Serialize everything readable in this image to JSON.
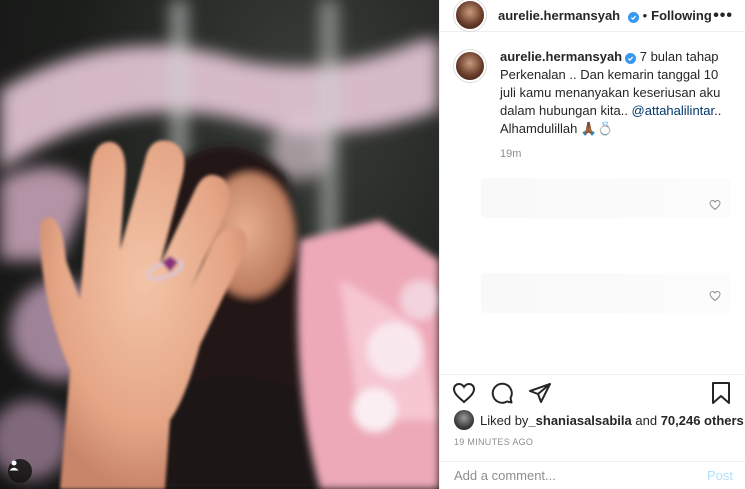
{
  "post": {
    "username": "aurelie.hermansyah",
    "separator": "•",
    "follow_label": "Following",
    "more_label": "•••"
  },
  "caption": {
    "username": "aurelie.hermansyah",
    "text_before": " 7 bulan tahap Perkenalan .. Dan kemarin tanggal 10 juli kamu menanyakan keseriusan aku dalam hubungan kita.. ",
    "mention": "@attahalilintar",
    "text_after": ".. Alhamdulillah 🙏🏾💍",
    "time": "19m"
  },
  "likes": {
    "prefix": "Liked by ",
    "user": "_shaniasalsabila",
    "middle": " and ",
    "count": "70,246 others"
  },
  "posted_time": "19 MINUTES AGO",
  "comment_input": {
    "placeholder": "Add a comment...",
    "post_label": "Post"
  },
  "colors": {
    "link": "#00376b",
    "verified": "#3897f0",
    "post_disabled": "#b2dffc",
    "muted": "#8e8e8e"
  },
  "icons": [
    "verified-badge-icon",
    "more-icon",
    "heart-icon",
    "comment-icon",
    "share-icon",
    "bookmark-icon",
    "user-tag-icon"
  ]
}
